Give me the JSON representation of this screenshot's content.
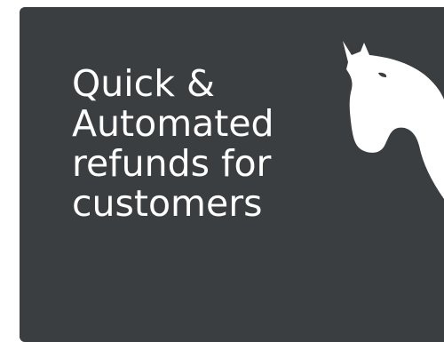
{
  "card": {
    "background": "#3b3e40",
    "headline_lines": [
      "Quick &",
      "Automated",
      "refunds for",
      "customers"
    ],
    "text_color": "#ffffff"
  },
  "icons": {
    "mascot": "horse-head-icon"
  }
}
